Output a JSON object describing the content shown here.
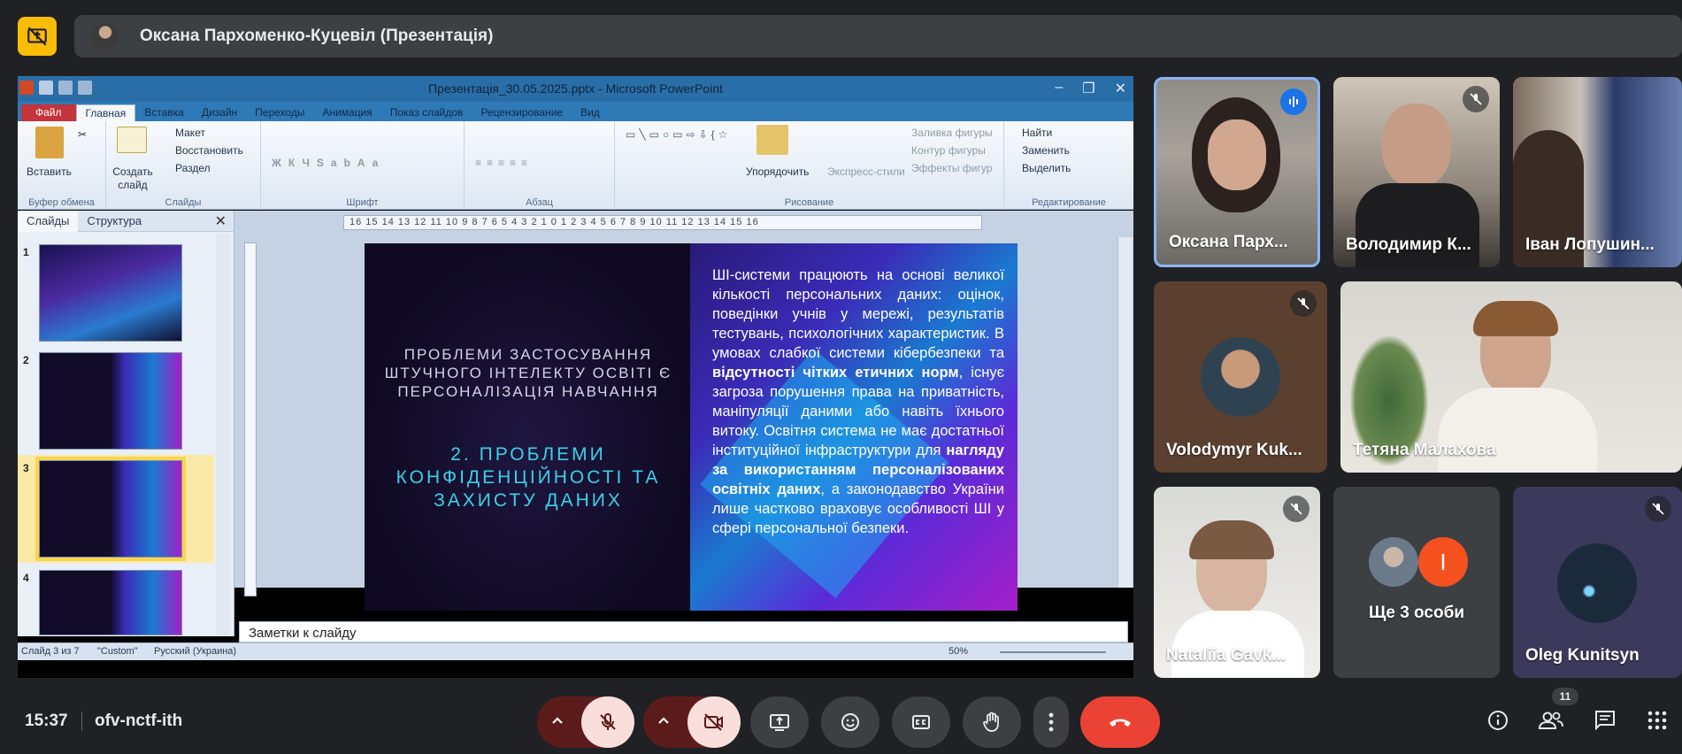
{
  "presenter_bar": {
    "label": "Оксана Пархоменко-Куцевіл (Презентація)",
    "icon": "present-to-all-off-icon"
  },
  "powerpoint": {
    "window_title": "Презентація_30.05.2025.pptx - Microsoft PowerPoint",
    "tabs": [
      "Файл",
      "Главная",
      "Вставка",
      "Дизайн",
      "Переходы",
      "Анимация",
      "Показ слайдов",
      "Рецензирование",
      "Вид"
    ],
    "ribbon": {
      "paste": "Вставить",
      "new_slide": "Создать слайд",
      "layout": "Макет",
      "reset": "Восстановить",
      "section": "Раздел",
      "arrange": "Упорядочить",
      "quick_styles": "Экспресс-стили",
      "shape_fill": "Заливка фигуры",
      "shape_outline": "Контур фигуры",
      "shape_effects": "Эффекты фигур",
      "find": "Найти",
      "replace": "Заменить",
      "select": "Выделить",
      "groups": [
        "Буфер обмена",
        "Слайды",
        "Шрифт",
        "Абзац",
        "Рисование",
        "Редактирование"
      ]
    },
    "pane_tabs": [
      "Слайды",
      "Структура"
    ],
    "thumbnails": [
      "1",
      "2",
      "3",
      "4"
    ],
    "selected_slide": "3",
    "ruler_text": "16 15 14 13 12 11 10 9 8 7 6 5 4 3 2 1 0 1 2 3 4 5 6 7 8 9 10 11 12 13 14 15 16",
    "slide": {
      "title_line": "ПРОБЛЕМИ ЗАСТОСУВАННЯ ШТУЧНОГО ІНТЕЛЕКТУ ОСВІТІ Є ПЕРСОНАЛІЗАЦІЯ НАВЧАННЯ",
      "section_title": "2. ПРОБЛЕМИ КОНФІДЕНЦІЙНОСТІ ТА ЗАХИСТУ ДАНИХ",
      "body_1": "ШІ-системи працюють на основі великої кількості персональних даних: оцінок, поведінки учнів у мережі, результатів тестувань, психологічних характеристик. В умовах слабкої системи кібербезпеки та ",
      "body_b1": "відсутності чітких етичних норм",
      "body_2": ", існує загроза порушення права на приватність, маніпуляції даними або навіть їхнього витоку. Освітня система не має достатньої інституційної інфраструктури для ",
      "body_b2": "нагляду за використанням персоналізованих освітніх даних",
      "body_3": ", а законодавство України лише частково враховує особливості ШІ у сфері персональної безпеки."
    },
    "notes_placeholder": "Заметки к слайду",
    "status": {
      "slide_of": "Слайд 3 из 7",
      "theme": "\"Custom\"",
      "language": "Русский (Украина)",
      "zoom": "50%"
    }
  },
  "participants": [
    {
      "name": "Оксана Парх...",
      "muted": false,
      "speaking": true
    },
    {
      "name": "Володимир К...",
      "muted": true
    },
    {
      "name": "Іван Лопушин...",
      "muted": false
    },
    {
      "name": "Volodymyr Kuk...",
      "muted": true
    },
    {
      "name": "Тетяна Малахова",
      "muted": false
    },
    {
      "name": "Nataliia Gavk...",
      "muted": true
    },
    {
      "name": "Ще 3 особи",
      "avatar_letter": "І"
    },
    {
      "name": "Oleg Kunitsyn",
      "muted": true
    }
  ],
  "bottom": {
    "time": "15:37",
    "meeting_code": "ofv-nctf-ith",
    "people_count": "11"
  },
  "colors": {
    "accent_red": "#ea4335",
    "muted_red": "#f9dedc",
    "presenter_yellow": "#fbbc04",
    "speaking_blue": "#8ab4f8"
  }
}
